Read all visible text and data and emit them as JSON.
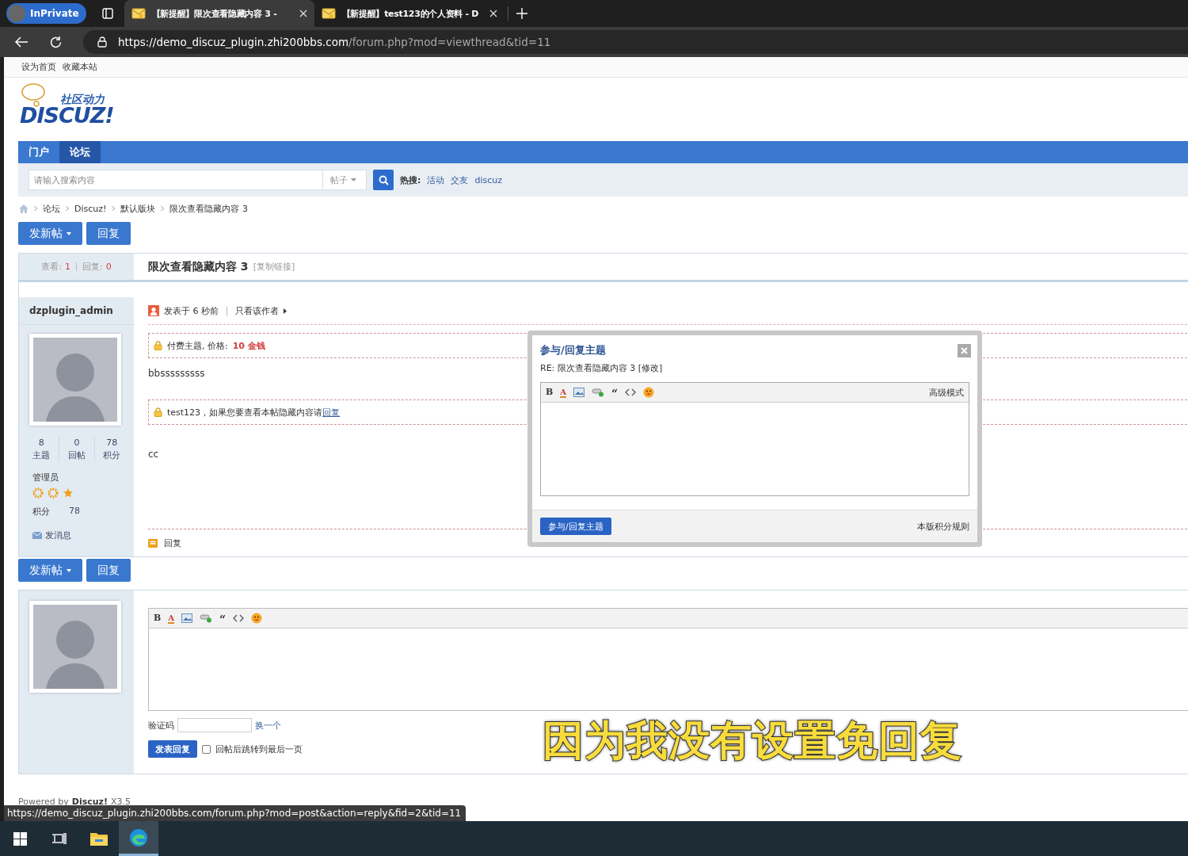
{
  "browser": {
    "private_label": "InPrivate",
    "tabs": [
      {
        "title": "【新提醒】限次查看隐藏内容 3 -",
        "selected": true
      },
      {
        "title": "【新提醒】test123的个人资料 - D",
        "selected": false
      }
    ],
    "url": {
      "host": "https://demo_discuz_plugin.zhi200bbs.com",
      "path": "/forum.php?mod=viewthread&tid=11"
    }
  },
  "top_links": [
    "设为首页",
    "收藏本站"
  ],
  "logo": {
    "tagline": "社区动力",
    "name": "DISCUZ!"
  },
  "nav": [
    {
      "label": "门户",
      "selected": false
    },
    {
      "label": "论坛",
      "selected": true
    }
  ],
  "search": {
    "placeholder": "请输入搜索内容",
    "type": "帖子",
    "hot_label": "热搜:",
    "hot": [
      "活动",
      "交友",
      "discuz"
    ]
  },
  "breadcrumb": [
    "论坛",
    "Discuz!",
    "默认版块",
    "限次查看隐藏内容 3"
  ],
  "actions_top": {
    "new_post": "发新帖",
    "reply": "回复"
  },
  "thread": {
    "views_label": "查看:",
    "views": "1",
    "replies_label": "回复:",
    "replies": "0",
    "title": "限次查看隐藏内容 3",
    "copy_link": "[复制链接]"
  },
  "author": {
    "name": "dzplugin_admin",
    "stats": [
      {
        "value": "8",
        "label": "主题"
      },
      {
        "value": "0",
        "label": "回帖"
      },
      {
        "value": "78",
        "label": "积分"
      }
    ],
    "group": "管理员",
    "credits_label": "积分",
    "credits": "78",
    "message_link": "发消息"
  },
  "post": {
    "posted": "发表于 6 秒前",
    "only_author": "只看该作者",
    "paid_notice": "付费主题, 价格:",
    "price": "10 金钱",
    "body": "bbsssssssss",
    "hidden_notice": "test123，如果您要查看本帖隐藏内容请",
    "hidden_link": "回复",
    "extra_body": "cc",
    "reply_link": "回复"
  },
  "actions_bottom": {
    "new_post": "发新帖",
    "reply": "回复"
  },
  "quick_reply": {
    "toolbar": [
      {
        "kind": "bold",
        "glyph": "B"
      },
      {
        "kind": "color",
        "glyph": "A"
      },
      {
        "kind": "image"
      },
      {
        "kind": "link"
      },
      {
        "kind": "quote",
        "glyph": "“"
      },
      {
        "kind": "code"
      },
      {
        "kind": "smiley"
      }
    ],
    "captcha_label": "验证码",
    "captcha_link": "换一个",
    "submit": "发表回复",
    "jump_label": "回帖后跳转到最后一页",
    "jump_checked": false
  },
  "footer": {
    "powered": "Powered by",
    "brand": "Discuz!",
    "version": "X3.5"
  },
  "status_url": "https://demo_discuz_plugin.zhi200bbs.com/forum.php?mod=post&action=reply&fid=2&tid=11",
  "modal": {
    "title": "参与/回复主题",
    "subtitle": "RE: 限次查看隐藏内容 3 [修改]",
    "toolbar": [
      {
        "kind": "bold",
        "glyph": "B"
      },
      {
        "kind": "color",
        "glyph": "A"
      },
      {
        "kind": "image"
      },
      {
        "kind": "link"
      },
      {
        "kind": "quote",
        "glyph": "“"
      },
      {
        "kind": "code"
      },
      {
        "kind": "smiley"
      }
    ],
    "advanced": "高级模式",
    "submit": "参与/回复主题",
    "rules": "本版积分规则"
  },
  "caption": "因为我没有设置免回复"
}
